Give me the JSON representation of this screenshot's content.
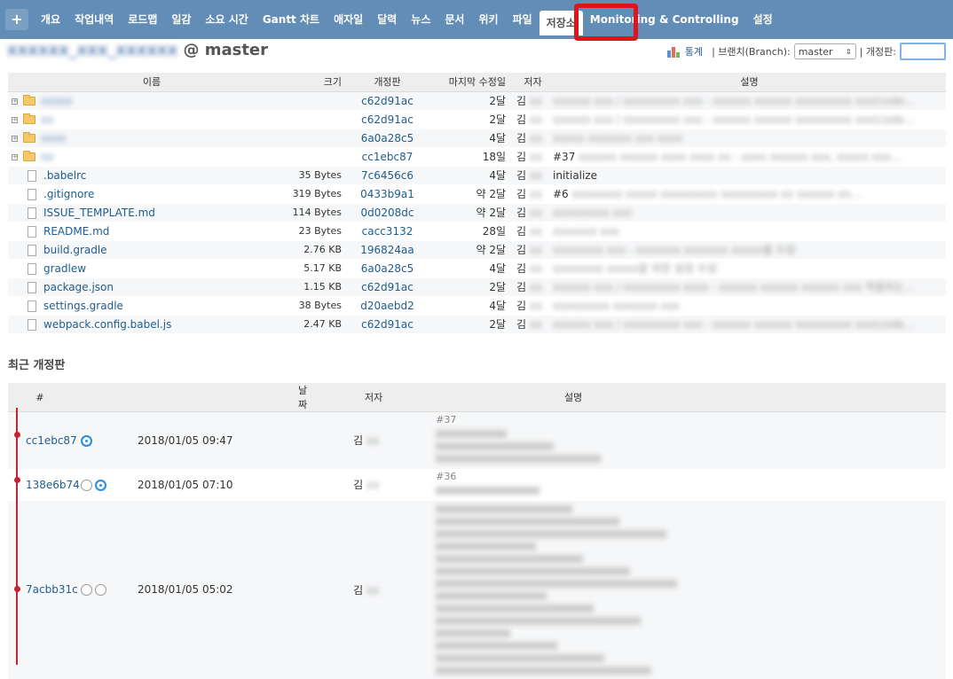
{
  "nav": {
    "plus": "+",
    "items": [
      "개요",
      "작업내역",
      "로드맵",
      "일감",
      "소요 시간",
      "Gantt 차트",
      "애자일",
      "달력",
      "뉴스",
      "문서",
      "위키",
      "파일",
      "저장소",
      "Monitoring & Controlling",
      "설정"
    ],
    "active_index": 12
  },
  "repo": {
    "name_blurred": "xxxxxx_xxx_xxxxxx",
    "branch_suffix": "@ master"
  },
  "header": {
    "stats_label": "통계",
    "branch_label": "| 브랜치(Branch):",
    "branch_value": "master",
    "revision_label": "| 개정판:"
  },
  "files_table": {
    "headers": [
      "이름",
      "크기",
      "개정판",
      "마지막 수정일",
      "저자",
      "설명"
    ],
    "rows": [
      {
        "type": "dir",
        "name": "xxxxx",
        "size": "",
        "rev": "c62d91ac",
        "age": "2달",
        "author": "김",
        "desc": "",
        "desc_blur": "xxxxxx xxx / xxxxxxxxx xxx - xxxxxx xxxxxx xxxxxxxxx xxx(code…"
      },
      {
        "type": "dir",
        "name": "xx",
        "size": "",
        "rev": "c62d91ac",
        "age": "2달",
        "author": "김",
        "desc": "",
        "desc_blur": "xxxxxx xxx / xxxxxxxxx xxx - xxxxxx xxxxxx xxxxxxxxx xxx(code…"
      },
      {
        "type": "dir",
        "name": "xxxx",
        "size": "",
        "rev": "6a0a28c5",
        "age": "4달",
        "author": "김",
        "desc": "",
        "desc_blur": "xxxxx xxxxxxx xxx xxxx"
      },
      {
        "type": "dir",
        "name": "xx",
        "size": "",
        "rev": "cc1ebc87",
        "age": "18일",
        "author": "김",
        "desc": "#37",
        "desc_blur": "xxxxxx xxxxxx xxxx xxxx xx - xxxx xxxxxx xxx, xxxxx xxx…"
      },
      {
        "type": "file",
        "name": ".babelrc",
        "size": "35 Bytes",
        "rev": "7c6456c6",
        "age": "4달",
        "author": "김",
        "desc": "initialize",
        "desc_blur": ""
      },
      {
        "type": "file",
        "name": ".gitignore",
        "size": "319 Bytes",
        "rev": "0433b9a1",
        "age": "약 2달",
        "author": "김",
        "desc": "#6",
        "desc_blur": "xxxxxxxx xxxxx xxxxxxxxx xxxxxxxxx xx xxxxxx xx…"
      },
      {
        "type": "file",
        "name": "ISSUE_TEMPLATE.md",
        "size": "114 Bytes",
        "rev": "0d0208dc",
        "age": "약 2달",
        "author": "김",
        "desc": "",
        "desc_blur": "xxxxxxxxx xxx"
      },
      {
        "type": "file",
        "name": "README.md",
        "size": "23 Bytes",
        "rev": "cacc3132",
        "age": "28일",
        "author": "김",
        "desc": "",
        "desc_blur": "xxxxxxx xxx"
      },
      {
        "type": "file",
        "name": "build.gradle",
        "size": "2.76 KB",
        "rev": "196824aa",
        "age": "약 2달",
        "author": "김",
        "desc": "",
        "desc_blur": "xxxxxxxx xxx - xxxxxxx xxxxxxx xxxxx를 수정"
      },
      {
        "type": "file",
        "name": "gradlew",
        "size": "5.17 KB",
        "rev": "6a0a28c5",
        "age": "4달",
        "author": "김",
        "desc": "",
        "desc_blur": "xxxxxxxx xxxxx을 위한 설정 수정"
      },
      {
        "type": "file",
        "name": "package.json",
        "size": "1.15 KB",
        "rev": "c62d91ac",
        "age": "2달",
        "author": "김",
        "desc": "",
        "desc_blur": "xxxxxx xxx / xxxxxxxxx xxxx - xxxxxx xxxxxx xxxxxx xxx 적용하는…"
      },
      {
        "type": "file",
        "name": "settings.gradle",
        "size": "38 Bytes",
        "rev": "d20aebd2",
        "age": "4달",
        "author": "김",
        "desc": "",
        "desc_blur": "xxxxxxxxx xxxxxxx xxx"
      },
      {
        "type": "file",
        "name": "webpack.config.babel.js",
        "size": "2.47 KB",
        "rev": "c62d91ac",
        "age": "2달",
        "author": "김",
        "desc": "",
        "desc_blur": "xxxxxx xxx / xxxxxxxxx xxx - xxxxxx xxxxxx xxxxxxxxx xxx(code…"
      }
    ]
  },
  "recent": {
    "title": "최근 개정판",
    "headers": [
      "#",
      "날짜",
      "저자",
      "설명"
    ],
    "rows": [
      {
        "id": "cc1ebc87",
        "date": "2018/01/05 09:47",
        "author": "김",
        "desc_first": "#37",
        "radios": [
          "on"
        ],
        "lines": 3
      },
      {
        "id": "138e6b74",
        "date": "2018/01/05 07:10",
        "author": "김",
        "desc_first": "#36",
        "radios": [
          "off",
          "on"
        ],
        "lines": 1
      },
      {
        "id": "7acbb31c",
        "date": "2018/01/05 05:02",
        "author": "김",
        "desc_first": "",
        "radios": [
          "off",
          "off"
        ],
        "lines": 14
      }
    ]
  },
  "colors": {
    "nav_bg": "#628db6",
    "link": "#205d8f",
    "highlight": "#e0151c",
    "graph": "#c5232f"
  }
}
